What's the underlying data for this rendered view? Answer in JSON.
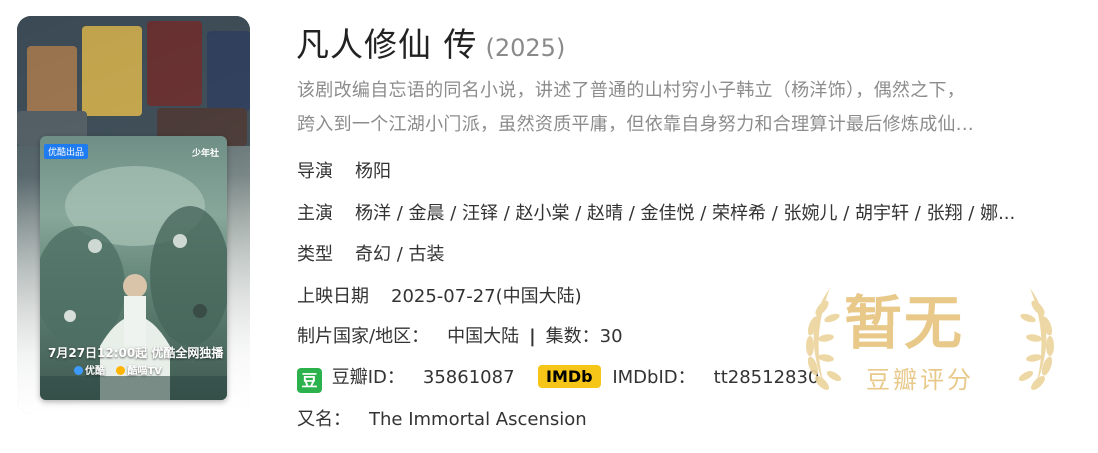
{
  "show": {
    "title": "凡人修仙 传",
    "year": "(2025)",
    "description_line1": "该剧改编自忘语的同名小说，讲述了普通的山村穷小子韩立（杨洋饰），偶然之下，",
    "description_line2": "跨入到一个江湖小门派，虽然资质平庸，但依靠自身努力和合理算计最后修炼成仙..."
  },
  "fields": {
    "director_label": "导演",
    "director_value": "杨阳",
    "cast_label": "主演",
    "cast_value": "杨洋 / 金晨 / 汪铎 / 赵小棠 / 赵晴 / 金佳悦 / 荣梓希 / 张婉儿 / 胡宇轩 / 张翔 / 娜...",
    "genre_label": "类型",
    "genre_value": "奇幻 / 古装",
    "release_label": "上映日期",
    "release_value": "2025-07-27(中国大陆)",
    "region_label": "制片国家/地区：",
    "region_value": "中国大陆",
    "episodes_sep": "|",
    "episodes_label": "集数：",
    "episodes_value": "30",
    "douban_icon_char": "豆",
    "douban_id_label": "豆瓣ID：",
    "douban_id_value": "35861087",
    "imdb_badge": "IMDb",
    "imdb_id_label": "IMDbID：",
    "imdb_id_value": "tt28512830",
    "alias_label": "又名：",
    "alias_value": "The Immortal Ascension"
  },
  "rating": {
    "main": "暂无",
    "sub": "豆瓣评分",
    "color": "#e8c98a"
  },
  "poster": {
    "badge": "优酷出品",
    "brand": "少年社",
    "date_text": "7月27日12:00起 优酷全网独播",
    "platform_1": "优酷",
    "platform_2": "酷喵TV"
  },
  "colors": {
    "douban_green": "#2bb24c",
    "imdb_yellow": "#f5c518"
  }
}
